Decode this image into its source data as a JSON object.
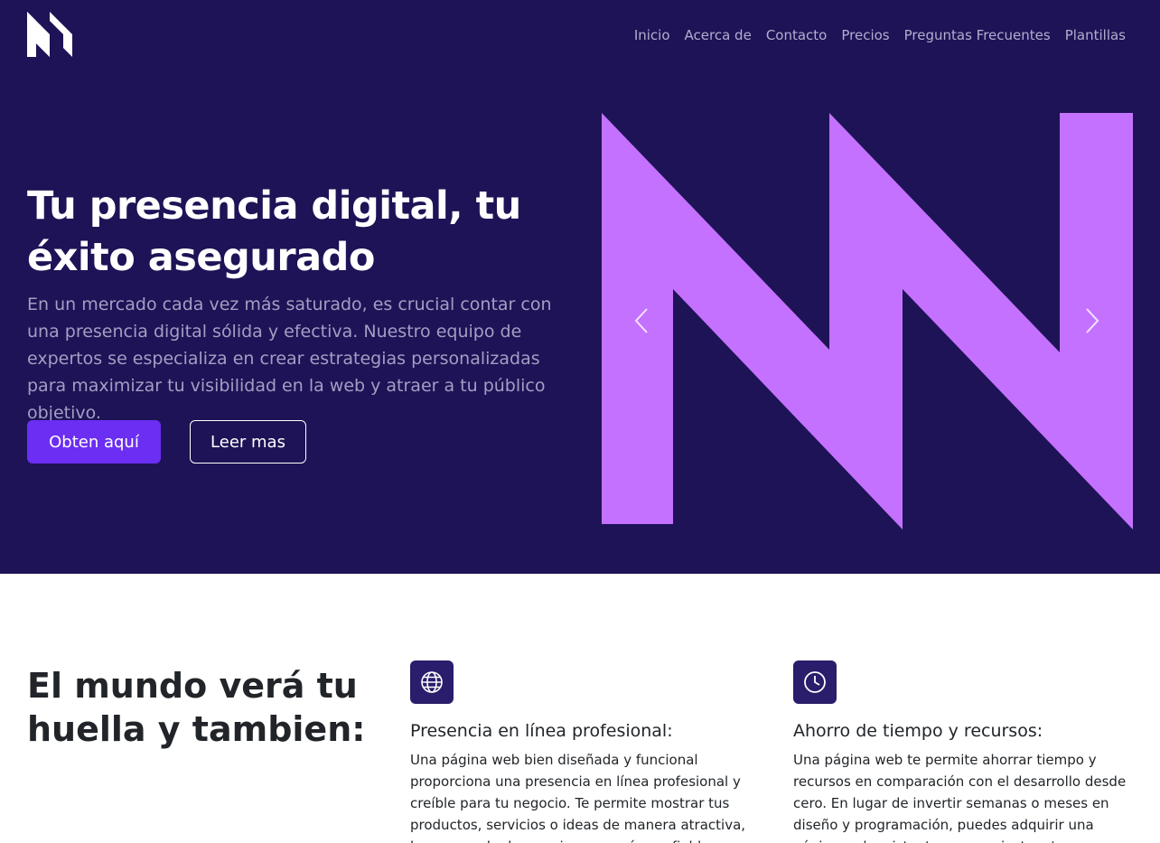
{
  "brand": {
    "logo_icon": "nn-logo-icon",
    "accent_color": "#c471ff",
    "hero_bg": "#1e1356",
    "primary_button_color": "#6b2ef2"
  },
  "nav": {
    "items": [
      "Inicio",
      "Acerca de",
      "Contacto",
      "Precios",
      "Preguntas Frecuentes",
      "Plantillas"
    ]
  },
  "hero": {
    "title": "Tu presencia digital, tu éxito asegurado",
    "description": "En un mercado cada vez más saturado, es crucial contar con una presencia digital sólida y efectiva. Nuestro equipo de expertos se especializa en crear estrategias personalizadas para maximizar tu visibilidad en la web y atraer a tu público objetivo.",
    "primary_button": "Obten aquí",
    "secondary_button": "Leer mas",
    "carousel": {
      "prev_icon": "chevron-left-icon",
      "next_icon": "chevron-right-icon",
      "slide_graphic": "nn-logo-graphic"
    }
  },
  "features": {
    "title": "El mundo verá tu huella y tambien:",
    "items": [
      {
        "icon": "globe-icon",
        "title": "Presencia en línea profesional:",
        "text": "Una página web bien diseñada y funcional proporciona una presencia en línea profesional y creíble para tu negocio. Te permite mostrar tus productos, servicios o ideas de manera atractiva, lo que puede dar una imagen más confiable."
      },
      {
        "icon": "clock-icon",
        "title": "Ahorro de tiempo y recursos:",
        "text": "Una página web te permite ahorrar tiempo y recursos en comparación con el desarrollo desde cero. En lugar de invertir semanas o meses en diseño y programación, puedes adquirir una página web existente que se ajuste a tus necesidades."
      }
    ]
  }
}
